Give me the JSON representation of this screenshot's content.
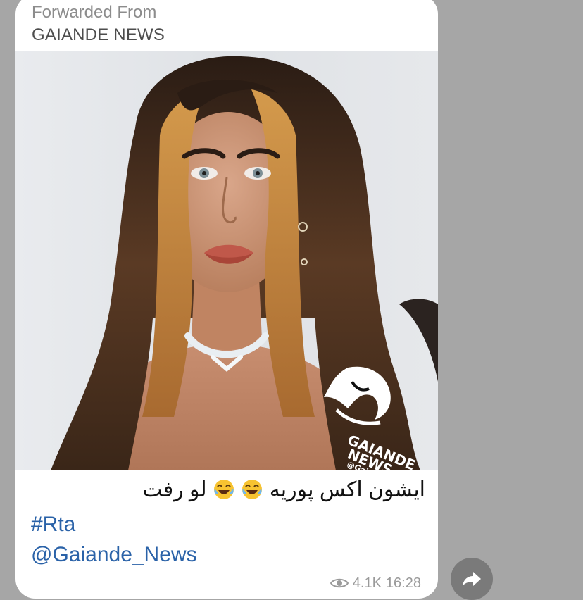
{
  "forward": {
    "caption": "Forwarded From",
    "source": "GAIANDE NEWS"
  },
  "photo": {
    "watermark_line1": "GAIANDE",
    "watermark_line2": "NEWS",
    "watermark_handle": "@Gaiande_News"
  },
  "message": {
    "text_main": "ایشون اکس پوریه",
    "text_tail": "لو رفت",
    "emoji_name": "face-with-tears-of-joy-icon",
    "hashtag": "#Rta",
    "mention": "@Gaiande_News"
  },
  "meta": {
    "views": "4.1K",
    "time": "16:28"
  },
  "colors": {
    "background": "#a6a6a6",
    "bubble": "#ffffff",
    "link": "#2a62a8",
    "muted": "#9a9a9a"
  }
}
